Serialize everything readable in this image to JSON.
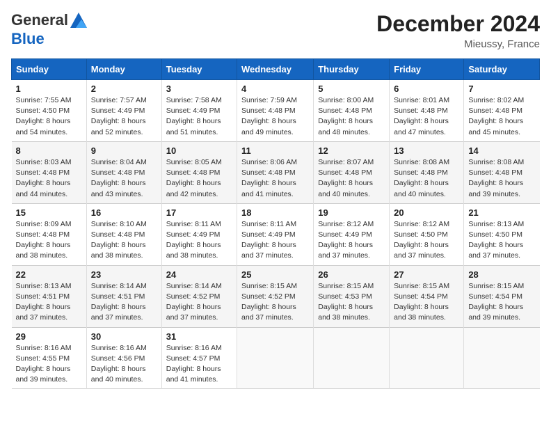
{
  "header": {
    "logo_line1": "General",
    "logo_line2": "Blue",
    "month_title": "December 2024",
    "location": "Mieussy, France"
  },
  "columns": [
    "Sunday",
    "Monday",
    "Tuesday",
    "Wednesday",
    "Thursday",
    "Friday",
    "Saturday"
  ],
  "weeks": [
    [
      {
        "day": "1",
        "sunrise": "Sunrise: 7:55 AM",
        "sunset": "Sunset: 4:50 PM",
        "daylight": "Daylight: 8 hours and 54 minutes."
      },
      {
        "day": "2",
        "sunrise": "Sunrise: 7:57 AM",
        "sunset": "Sunset: 4:49 PM",
        "daylight": "Daylight: 8 hours and 52 minutes."
      },
      {
        "day": "3",
        "sunrise": "Sunrise: 7:58 AM",
        "sunset": "Sunset: 4:49 PM",
        "daylight": "Daylight: 8 hours and 51 minutes."
      },
      {
        "day": "4",
        "sunrise": "Sunrise: 7:59 AM",
        "sunset": "Sunset: 4:48 PM",
        "daylight": "Daylight: 8 hours and 49 minutes."
      },
      {
        "day": "5",
        "sunrise": "Sunrise: 8:00 AM",
        "sunset": "Sunset: 4:48 PM",
        "daylight": "Daylight: 8 hours and 48 minutes."
      },
      {
        "day": "6",
        "sunrise": "Sunrise: 8:01 AM",
        "sunset": "Sunset: 4:48 PM",
        "daylight": "Daylight: 8 hours and 47 minutes."
      },
      {
        "day": "7",
        "sunrise": "Sunrise: 8:02 AM",
        "sunset": "Sunset: 4:48 PM",
        "daylight": "Daylight: 8 hours and 45 minutes."
      }
    ],
    [
      {
        "day": "8",
        "sunrise": "Sunrise: 8:03 AM",
        "sunset": "Sunset: 4:48 PM",
        "daylight": "Daylight: 8 hours and 44 minutes."
      },
      {
        "day": "9",
        "sunrise": "Sunrise: 8:04 AM",
        "sunset": "Sunset: 4:48 PM",
        "daylight": "Daylight: 8 hours and 43 minutes."
      },
      {
        "day": "10",
        "sunrise": "Sunrise: 8:05 AM",
        "sunset": "Sunset: 4:48 PM",
        "daylight": "Daylight: 8 hours and 42 minutes."
      },
      {
        "day": "11",
        "sunrise": "Sunrise: 8:06 AM",
        "sunset": "Sunset: 4:48 PM",
        "daylight": "Daylight: 8 hours and 41 minutes."
      },
      {
        "day": "12",
        "sunrise": "Sunrise: 8:07 AM",
        "sunset": "Sunset: 4:48 PM",
        "daylight": "Daylight: 8 hours and 40 minutes."
      },
      {
        "day": "13",
        "sunrise": "Sunrise: 8:08 AM",
        "sunset": "Sunset: 4:48 PM",
        "daylight": "Daylight: 8 hours and 40 minutes."
      },
      {
        "day": "14",
        "sunrise": "Sunrise: 8:08 AM",
        "sunset": "Sunset: 4:48 PM",
        "daylight": "Daylight: 8 hours and 39 minutes."
      }
    ],
    [
      {
        "day": "15",
        "sunrise": "Sunrise: 8:09 AM",
        "sunset": "Sunset: 4:48 PM",
        "daylight": "Daylight: 8 hours and 38 minutes."
      },
      {
        "day": "16",
        "sunrise": "Sunrise: 8:10 AM",
        "sunset": "Sunset: 4:48 PM",
        "daylight": "Daylight: 8 hours and 38 minutes."
      },
      {
        "day": "17",
        "sunrise": "Sunrise: 8:11 AM",
        "sunset": "Sunset: 4:49 PM",
        "daylight": "Daylight: 8 hours and 38 minutes."
      },
      {
        "day": "18",
        "sunrise": "Sunrise: 8:11 AM",
        "sunset": "Sunset: 4:49 PM",
        "daylight": "Daylight: 8 hours and 37 minutes."
      },
      {
        "day": "19",
        "sunrise": "Sunrise: 8:12 AM",
        "sunset": "Sunset: 4:49 PM",
        "daylight": "Daylight: 8 hours and 37 minutes."
      },
      {
        "day": "20",
        "sunrise": "Sunrise: 8:12 AM",
        "sunset": "Sunset: 4:50 PM",
        "daylight": "Daylight: 8 hours and 37 minutes."
      },
      {
        "day": "21",
        "sunrise": "Sunrise: 8:13 AM",
        "sunset": "Sunset: 4:50 PM",
        "daylight": "Daylight: 8 hours and 37 minutes."
      }
    ],
    [
      {
        "day": "22",
        "sunrise": "Sunrise: 8:13 AM",
        "sunset": "Sunset: 4:51 PM",
        "daylight": "Daylight: 8 hours and 37 minutes."
      },
      {
        "day": "23",
        "sunrise": "Sunrise: 8:14 AM",
        "sunset": "Sunset: 4:51 PM",
        "daylight": "Daylight: 8 hours and 37 minutes."
      },
      {
        "day": "24",
        "sunrise": "Sunrise: 8:14 AM",
        "sunset": "Sunset: 4:52 PM",
        "daylight": "Daylight: 8 hours and 37 minutes."
      },
      {
        "day": "25",
        "sunrise": "Sunrise: 8:15 AM",
        "sunset": "Sunset: 4:52 PM",
        "daylight": "Daylight: 8 hours and 37 minutes."
      },
      {
        "day": "26",
        "sunrise": "Sunrise: 8:15 AM",
        "sunset": "Sunset: 4:53 PM",
        "daylight": "Daylight: 8 hours and 38 minutes."
      },
      {
        "day": "27",
        "sunrise": "Sunrise: 8:15 AM",
        "sunset": "Sunset: 4:54 PM",
        "daylight": "Daylight: 8 hours and 38 minutes."
      },
      {
        "day": "28",
        "sunrise": "Sunrise: 8:15 AM",
        "sunset": "Sunset: 4:54 PM",
        "daylight": "Daylight: 8 hours and 39 minutes."
      }
    ],
    [
      {
        "day": "29",
        "sunrise": "Sunrise: 8:16 AM",
        "sunset": "Sunset: 4:55 PM",
        "daylight": "Daylight: 8 hours and 39 minutes."
      },
      {
        "day": "30",
        "sunrise": "Sunrise: 8:16 AM",
        "sunset": "Sunset: 4:56 PM",
        "daylight": "Daylight: 8 hours and 40 minutes."
      },
      {
        "day": "31",
        "sunrise": "Sunrise: 8:16 AM",
        "sunset": "Sunset: 4:57 PM",
        "daylight": "Daylight: 8 hours and 41 minutes."
      },
      null,
      null,
      null,
      null
    ]
  ]
}
